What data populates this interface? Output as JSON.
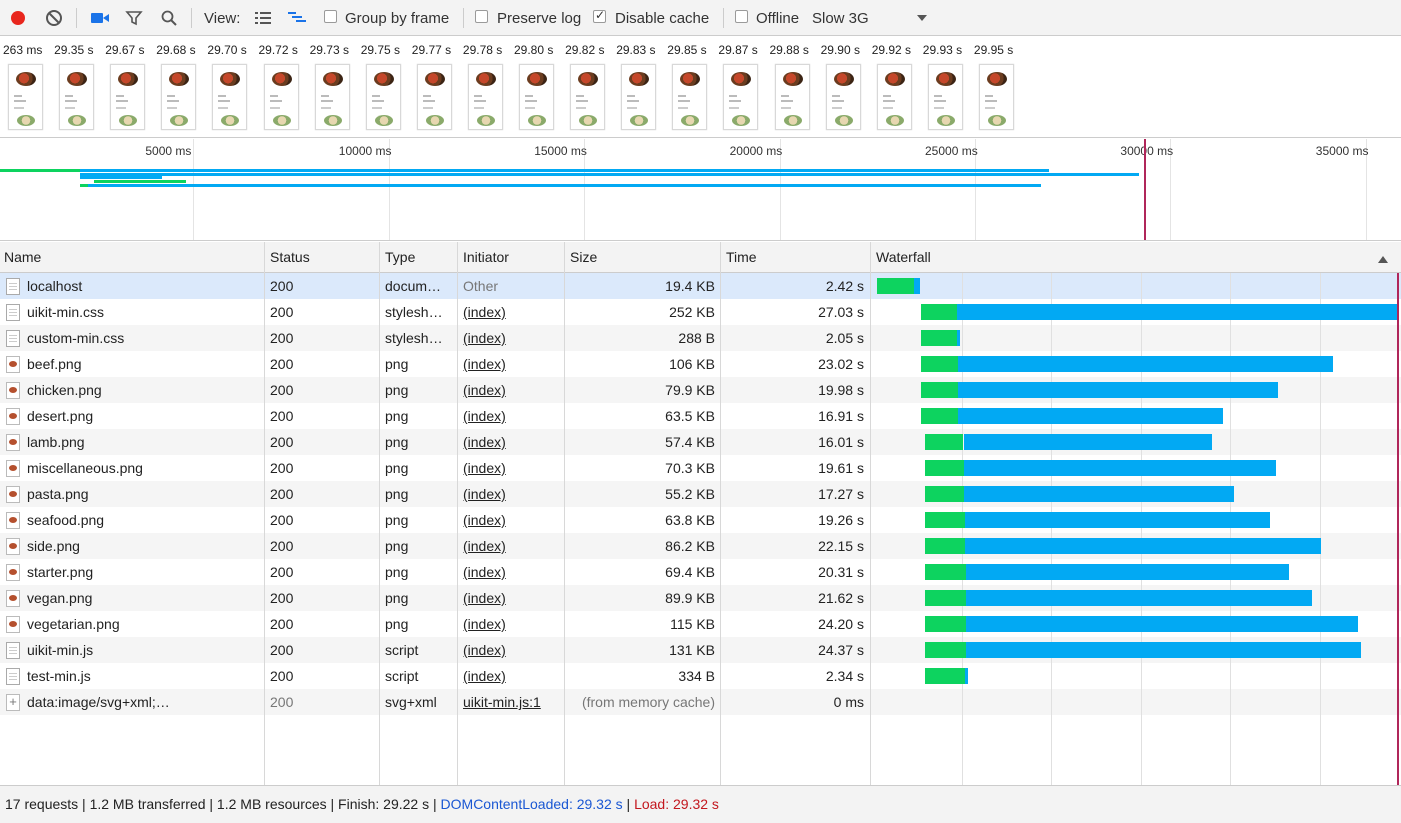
{
  "toolbar": {
    "view_label": "View:",
    "group_by_frame": "Group by frame",
    "preserve_log": "Preserve log",
    "disable_cache": "Disable cache",
    "offline": "Offline",
    "throttle": "Slow 3G",
    "disable_cache_checked": true,
    "record_color": "#e8261d"
  },
  "filmstrip": {
    "times": [
      "263 ms",
      "29.35 s",
      "29.67 s",
      "29.68 s",
      "29.70 s",
      "29.72 s",
      "29.73 s",
      "29.75 s",
      "29.77 s",
      "29.78 s",
      "29.80 s",
      "29.82 s",
      "29.83 s",
      "29.85 s",
      "29.87 s",
      "29.88 s",
      "29.90 s",
      "29.92 s",
      "29.93 s",
      "29.95 s"
    ]
  },
  "overview": {
    "ticks": [
      "5000 ms",
      "10000 ms",
      "15000 ms",
      "20000 ms",
      "25000 ms",
      "30000 ms",
      "35000 ms"
    ]
  },
  "columns": {
    "name": "Name",
    "status": "Status",
    "type": "Type",
    "initiator": "Initiator",
    "size": "Size",
    "time": "Time",
    "waterfall": "Waterfall"
  },
  "requests": [
    {
      "name": "localhost",
      "status": "200",
      "type": "docum…",
      "initiator": "Other",
      "size": "19.4 KB",
      "time": "2.42 s",
      "start_s": 0.17,
      "ttfb_s": 2.08,
      "dur_s": 2.42
    },
    {
      "name": "uikit-min.css",
      "status": "200",
      "type": "stylesh…",
      "initiator": "(index)",
      "size": "252 KB",
      "time": "27.03 s",
      "start_s": 2.6,
      "ttfb_s": 2.05,
      "dur_s": 27.03
    },
    {
      "name": "custom-min.css",
      "status": "200",
      "type": "stylesh…",
      "initiator": "(index)",
      "size": "288 B",
      "time": "2.05 s",
      "start_s": 2.6,
      "ttfb_s": 2.05,
      "dur_s": 2.05
    },
    {
      "name": "beef.png",
      "status": "200",
      "type": "png",
      "initiator": "(index)",
      "size": "106 KB",
      "time": "23.02 s",
      "start_s": 2.6,
      "ttfb_s": 2.1,
      "dur_s": 23.02
    },
    {
      "name": "chicken.png",
      "status": "200",
      "type": "png",
      "initiator": "(index)",
      "size": "79.9 KB",
      "time": "19.98 s",
      "start_s": 2.6,
      "ttfb_s": 2.1,
      "dur_s": 19.98
    },
    {
      "name": "desert.png",
      "status": "200",
      "type": "png",
      "initiator": "(index)",
      "size": "63.5 KB",
      "time": "16.91 s",
      "start_s": 2.6,
      "ttfb_s": 2.1,
      "dur_s": 16.91
    },
    {
      "name": "lamb.png",
      "status": "200",
      "type": "png",
      "initiator": "(index)",
      "size": "57.4 KB",
      "time": "16.01 s",
      "start_s": 2.85,
      "ttfb_s": 2.15,
      "dur_s": 16.01
    },
    {
      "name": "miscellaneous.png",
      "status": "200",
      "type": "png",
      "initiator": "(index)",
      "size": "70.3 KB",
      "time": "19.61 s",
      "start_s": 2.85,
      "ttfb_s": 2.2,
      "dur_s": 19.61
    },
    {
      "name": "pasta.png",
      "status": "200",
      "type": "png",
      "initiator": "(index)",
      "size": "55.2 KB",
      "time": "17.27 s",
      "start_s": 2.85,
      "ttfb_s": 2.2,
      "dur_s": 17.27
    },
    {
      "name": "seafood.png",
      "status": "200",
      "type": "png",
      "initiator": "(index)",
      "size": "63.8 KB",
      "time": "19.26 s",
      "start_s": 2.85,
      "ttfb_s": 2.25,
      "dur_s": 19.26
    },
    {
      "name": "side.png",
      "status": "200",
      "type": "png",
      "initiator": "(index)",
      "size": "86.2 KB",
      "time": "22.15 s",
      "start_s": 2.85,
      "ttfb_s": 2.25,
      "dur_s": 22.15
    },
    {
      "name": "starter.png",
      "status": "200",
      "type": "png",
      "initiator": "(index)",
      "size": "69.4 KB",
      "time": "20.31 s",
      "start_s": 2.85,
      "ttfb_s": 2.3,
      "dur_s": 20.31
    },
    {
      "name": "vegan.png",
      "status": "200",
      "type": "png",
      "initiator": "(index)",
      "size": "89.9 KB",
      "time": "21.62 s",
      "start_s": 2.85,
      "ttfb_s": 2.3,
      "dur_s": 21.62
    },
    {
      "name": "vegetarian.png",
      "status": "200",
      "type": "png",
      "initiator": "(index)",
      "size": "115 KB",
      "time": "24.20 s",
      "start_s": 2.85,
      "ttfb_s": 2.3,
      "dur_s": 24.2
    },
    {
      "name": "uikit-min.js",
      "status": "200",
      "type": "script",
      "initiator": "(index)",
      "size": "131 KB",
      "time": "24.37 s",
      "start_s": 2.85,
      "ttfb_s": 2.3,
      "dur_s": 24.37
    },
    {
      "name": "test-min.js",
      "status": "200",
      "type": "script",
      "initiator": "(index)",
      "size": "334 B",
      "time": "2.34 s",
      "start_s": 2.85,
      "ttfb_s": 2.25,
      "dur_s": 2.34
    },
    {
      "name": "data:image/svg+xml;…",
      "status": "200",
      "type": "svg+xml",
      "initiator": "uikit-min.js:1",
      "size": "(from memory cache)",
      "time": "0 ms",
      "start_s": 29.2,
      "ttfb_s": 0,
      "dur_s": 0
    }
  ],
  "status_bar": {
    "summary": "17 requests | 1.2 MB transferred | 1.2 MB resources | Finish: 29.22 s | ",
    "dcl": "DOMContentLoaded: 29.32 s",
    "sep": " | ",
    "load": "Load: 29.32 s"
  },
  "colors": {
    "waiting": "#0dd35f",
    "download": "#02a9f3",
    "load_line": "#b0265a",
    "dcl_text": "#1a57d3",
    "load_text": "#c3171e",
    "selected_row": "#dbe9fb"
  }
}
